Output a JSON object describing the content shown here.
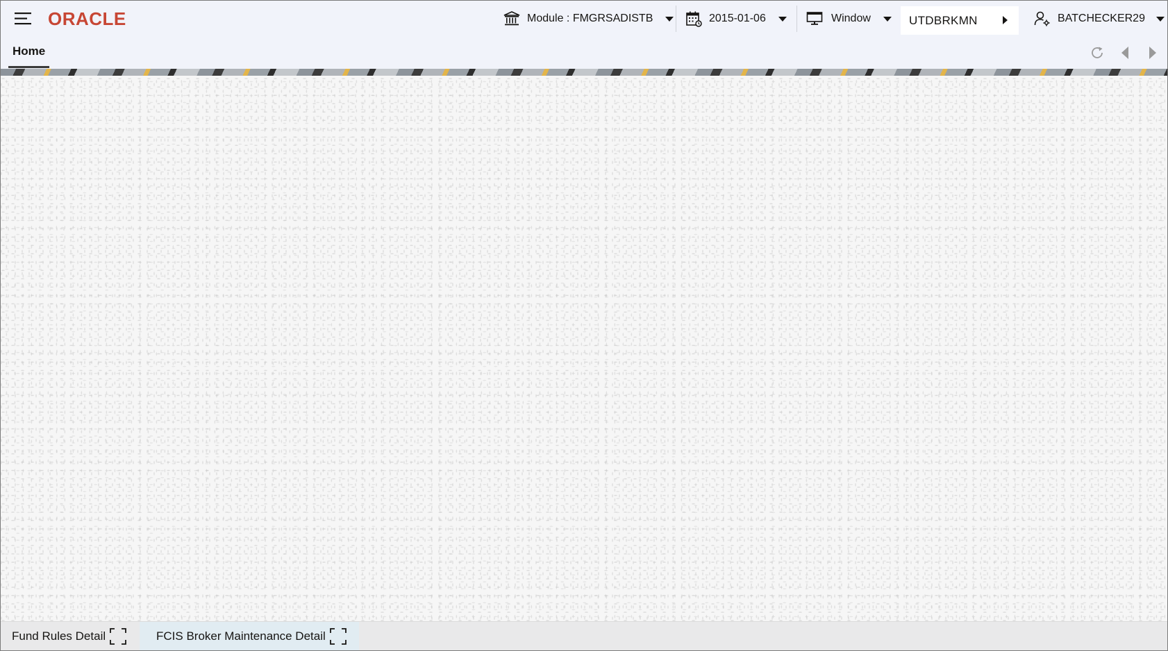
{
  "header": {
    "logo_text": "ORACLE",
    "module_label": "Module : FMGRSADISTB",
    "date_label": "2015-01-06",
    "window_label": "Window",
    "branch_label": "UTDBRKMN",
    "user_label": "BATCHECKER29"
  },
  "tabs": [
    {
      "label": "Home",
      "active": true
    }
  ],
  "taskbar": {
    "items": [
      {
        "label": "Fund Rules Detail"
      },
      {
        "label": "FCIS Broker Maintenance Detail"
      }
    ]
  },
  "colors": {
    "brand": "#c74634",
    "header_bg": "#f1f3fa",
    "taskbar_bg": "#e9e9ea",
    "active_task_bg": "#e1ecf2"
  },
  "icons": {
    "menu": "hamburger-menu-icon",
    "module": "bank-icon",
    "date": "calendar-icon",
    "window": "monitor-icon",
    "user": "user-settings-icon",
    "refresh": "refresh-icon",
    "prev": "chevron-left-icon",
    "next": "chevron-right-icon",
    "maximize": "maximize-icon"
  }
}
